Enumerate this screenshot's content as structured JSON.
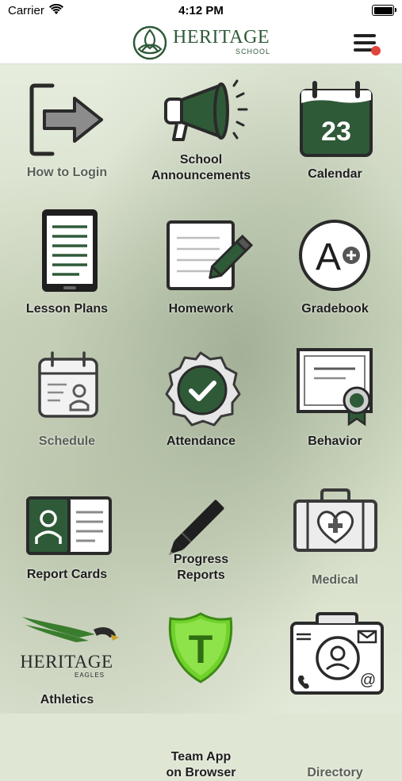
{
  "status_bar": {
    "carrier": "Carrier",
    "time": "4:12 PM"
  },
  "header": {
    "logo_name": "HERITAGE",
    "logo_sub": "SCHOOL"
  },
  "colors": {
    "brand_green": "#2f5a38",
    "notification": "#e2453b",
    "athletics_green": "#3a7d2e",
    "team_app_green": "#6fd12a"
  },
  "tiles": [
    {
      "label": "How to Login",
      "icon": "login-arrow-icon"
    },
    {
      "label": "School Announcements",
      "line1": "School",
      "line2": "Announcements",
      "icon": "megaphone-icon"
    },
    {
      "label": "Calendar",
      "icon": "calendar-icon",
      "day": "23"
    },
    {
      "label": "Lesson Plans",
      "icon": "tablet-icon"
    },
    {
      "label": "Homework",
      "icon": "notepad-pencil-icon"
    },
    {
      "label": "Gradebook",
      "icon": "grade-a-plus-icon",
      "grade": "A"
    },
    {
      "label": "Schedule",
      "icon": "schedule-calendar-icon"
    },
    {
      "label": "Attendance",
      "icon": "checkmark-badge-icon"
    },
    {
      "label": "Behavior",
      "icon": "certificate-icon"
    },
    {
      "label": "Report Cards",
      "icon": "report-card-icon"
    },
    {
      "label": "Progress Reports",
      "line1": "Progress",
      "line2": "Reports",
      "icon": "pencil-icon"
    },
    {
      "label": "Medical",
      "icon": "medical-kit-icon"
    },
    {
      "label": "Athletics",
      "icon": "heritage-eagles-logo",
      "logo_name": "HERITAGE",
      "logo_sub": "EAGLES"
    },
    {
      "label": "Team App on Browser",
      "line1": "Team App",
      "line2": "on Browser",
      "icon": "team-app-shield-icon",
      "shield_letter": "T"
    },
    {
      "label": "Directory",
      "icon": "directory-id-icon",
      "at_symbol": "@"
    }
  ]
}
